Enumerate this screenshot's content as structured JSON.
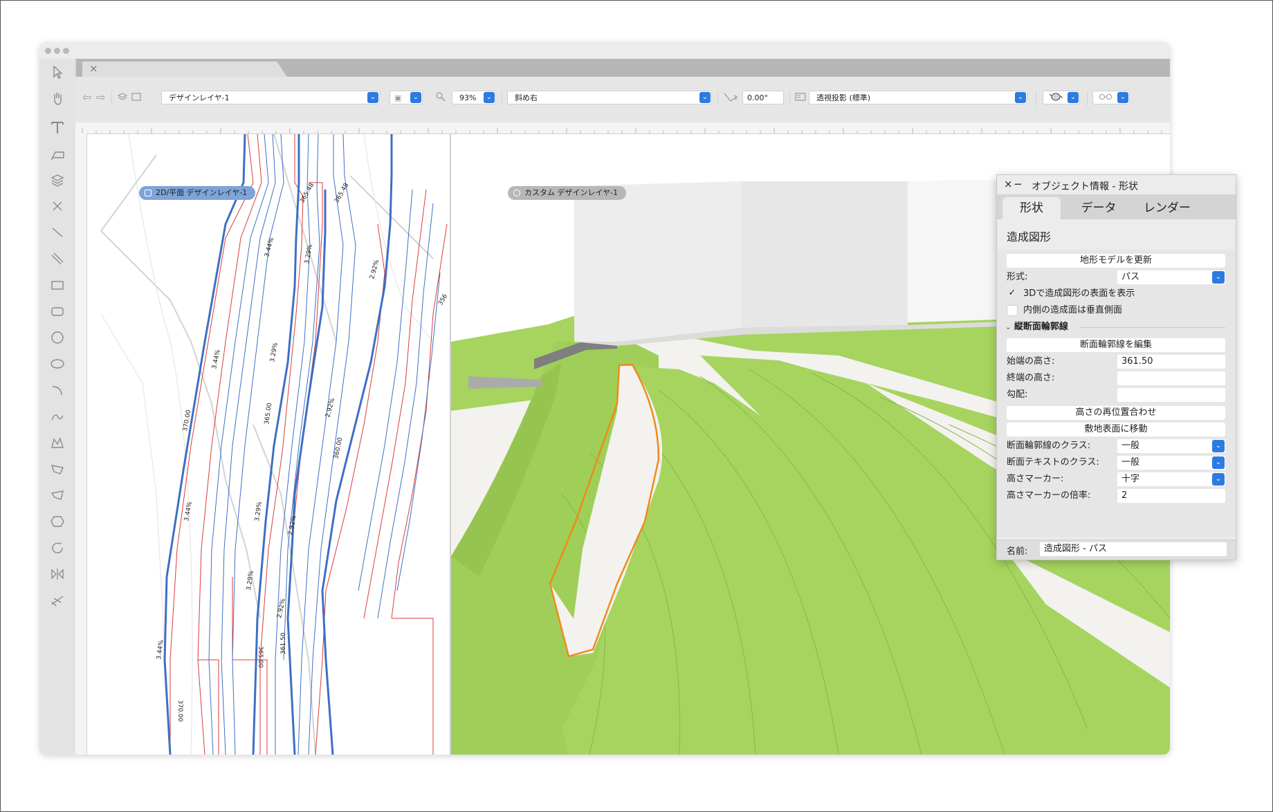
{
  "toolbar": {
    "layer_select": "デザインレイヤ-1",
    "zoom": "93%",
    "view_select": "斜め右",
    "angle": "0.00°",
    "projection_select": "透視投影 (標準)"
  },
  "view2d": {
    "label": "2D/平面  デザインレイヤ-1",
    "annotations": [
      "365.48",
      "365.48",
      "3.44%",
      "3.29%",
      "2.92%",
      "3.44%",
      "370.00",
      "365.00",
      "3.29%",
      "2.92%",
      "360.00",
      "3.29%",
      "3.44%",
      "2.92%",
      "3.29%",
      "2.92%",
      "365.00",
      "361.50",
      "3.44%",
      "370.00",
      "356"
    ]
  },
  "view3d": {
    "label": "カスタム  デザインレイヤ-1"
  },
  "oip": {
    "title": "オブジェクト情報 - 形状",
    "tabs": [
      "形状",
      "データ",
      "レンダー"
    ],
    "object_type": "造成図形",
    "update_button": "地形モデルを更新",
    "form_label": "形式:",
    "form_value": "パス",
    "show3d_label": "3Dで造成図形の表面を表示",
    "show3d_checked": "✓",
    "vertical_label": "内側の造成面は垂直側面",
    "section_title": "縦断面輪郭線",
    "edit_profile_button": "断面輪郭線を編集",
    "start_label": "始端の高さ:",
    "start_value": "361.50",
    "end_label": "終端の高さ:",
    "end_value": "",
    "slope_label": "勾配:",
    "slope_value": "",
    "reposition_button": "高さの再位置合わせ",
    "move_button": "敷地表面に移動",
    "class_label": "断面輪郭線のクラス:",
    "class_value": "一般",
    "text_class_label": "断面テキストのクラス:",
    "text_class_value": "一般",
    "marker_label": "高さマーカー:",
    "marker_value": "十字",
    "marker_scale_label": "高さマーカーの倍率:",
    "marker_scale_value": "2",
    "name_label": "名前:",
    "name_value": "造成図形 - パス"
  },
  "colors": {
    "accent": "#2d7be0",
    "grass": "#a6d45f",
    "path": "#f3f2ef",
    "highlight": "#f08a1a",
    "contour_blue": "#3d6fc4",
    "contour_red": "#d93a3a"
  }
}
